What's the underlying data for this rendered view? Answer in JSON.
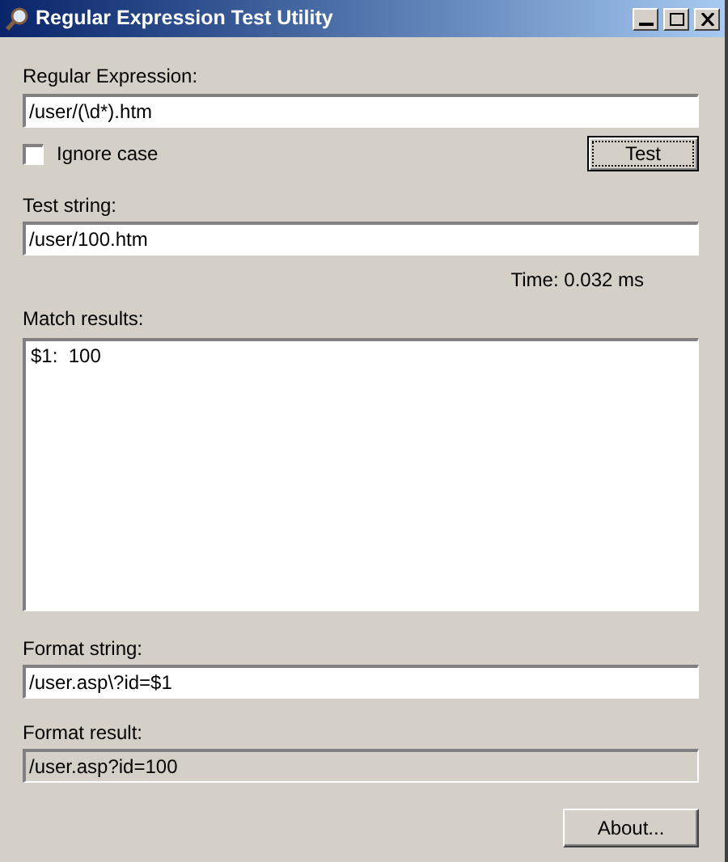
{
  "window": {
    "title": "Regular Expression Test Utility"
  },
  "regex": {
    "label": "Regular Expression:",
    "value": "/user/(\\d*).htm"
  },
  "ignore_case": {
    "label": "Ignore case",
    "checked": false
  },
  "test_button": {
    "label": "Test"
  },
  "test_string": {
    "label": "Test string:",
    "value": "/user/100.htm"
  },
  "time": "Time: 0.032 ms",
  "match_results": {
    "label": "Match results:",
    "lines": [
      "$1:  100"
    ]
  },
  "format_string": {
    "label": "Format string:",
    "value": "/user.asp\\?id=$1"
  },
  "format_result": {
    "label": "Format result:",
    "value": "/user.asp?id=100"
  },
  "about_button": {
    "label": "About..."
  }
}
